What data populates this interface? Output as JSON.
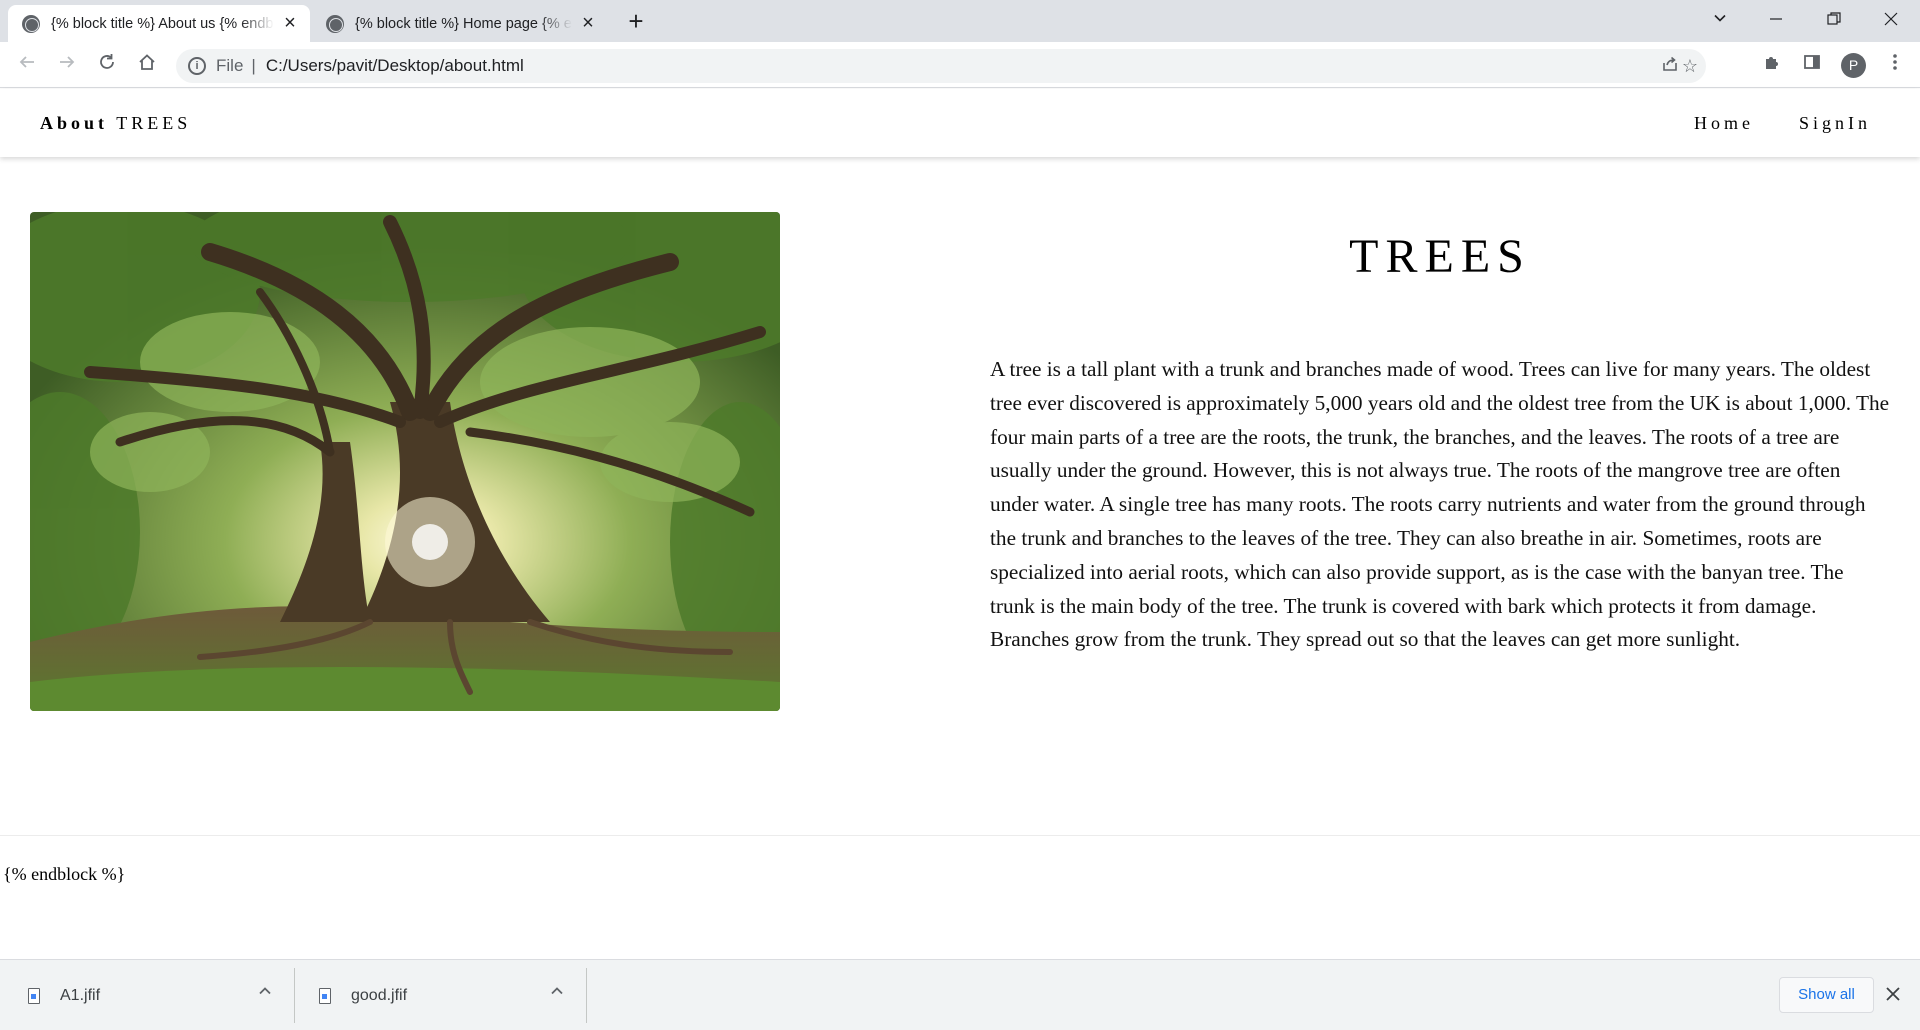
{
  "browser": {
    "tabs": [
      {
        "title": "{% block title %} About us {% endblock %}",
        "active": true
      },
      {
        "title": "{% block title %} Home page {% endblock %}",
        "active": false
      }
    ],
    "new_tab_icon": "plus-icon",
    "address": {
      "scheme_label": "File",
      "separator": "|",
      "url": "C:/Users/pavit/Desktop/about.html"
    },
    "profile_initial": "P",
    "window_controls": [
      "chevron-down-icon",
      "minimize-icon",
      "restore-icon",
      "close-icon"
    ]
  },
  "site": {
    "brand_bold": "About",
    "brand_rest": "TREES",
    "nav": [
      {
        "label": "Home"
      },
      {
        "label": "SignIn"
      }
    ],
    "hero": {
      "heading": "TREES",
      "image_alt": "tree-photo",
      "paragraph": "A tree is a tall plant with a trunk and branches made of wood. Trees can live for many years. The oldest tree ever discovered is approximately 5,000 years old and the oldest tree from the UK is about 1,000. The four main parts of a tree are the roots, the trunk, the branches, and the leaves. The roots of a tree are usually under the ground. However, this is not always true. The roots of the mangrove tree are often under water. A single tree has many roots. The roots carry nutrients and water from the ground through the trunk and branches to the leaves of the tree. They can also breathe in air. Sometimes, roots are specialized into aerial roots, which can also provide support, as is the case with the banyan tree. The trunk is the main body of the tree. The trunk is covered with bark which protects it from damage. Branches grow from the trunk. They spread out so that the leaves can get more sunlight."
    },
    "template_tag": "{% endblock %}"
  },
  "downloads": {
    "items": [
      {
        "name": "A1.jfif"
      },
      {
        "name": "good.jfif"
      }
    ],
    "show_all": "Show all"
  }
}
